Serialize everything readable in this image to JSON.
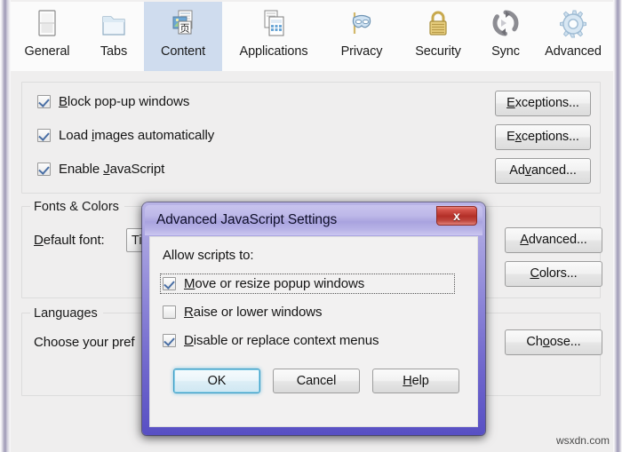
{
  "window": {
    "toolbar_tabs": [
      {
        "label": "General",
        "icon": "document-page-icon",
        "selected": false
      },
      {
        "label": "Tabs",
        "icon": "folder-tab-icon",
        "selected": false
      },
      {
        "label": "Content",
        "icon": "content-pages-icon",
        "selected": true
      },
      {
        "label": "Applications",
        "icon": "applications-icon",
        "selected": false
      },
      {
        "label": "Privacy",
        "icon": "mask-icon",
        "selected": false
      },
      {
        "label": "Security",
        "icon": "padlock-icon",
        "selected": false
      },
      {
        "label": "Sync",
        "icon": "sync-arrows-icon",
        "selected": false
      },
      {
        "label": "Advanced",
        "icon": "gear-icon",
        "selected": false
      }
    ]
  },
  "content_panel": {
    "checkboxes": [
      {
        "label_pre": "",
        "mnemonic": "B",
        "label_post": "lock pop-up windows",
        "checked": true
      },
      {
        "label_pre": "Load ",
        "mnemonic": "i",
        "label_post": "mages automatically",
        "checked": true
      },
      {
        "label_pre": "Enable ",
        "mnemonic": "J",
        "label_post": "avaScript",
        "checked": true
      }
    ],
    "side_buttons": [
      {
        "label_pre": "",
        "mnemonic": "E",
        "label_post": "xceptions..."
      },
      {
        "label_pre": "E",
        "mnemonic": "x",
        "label_post": "ceptions..."
      },
      {
        "label_pre": "Ad",
        "mnemonic": "v",
        "label_post": "anced..."
      }
    ],
    "fonts_group": {
      "legend": "Fonts & Colors",
      "default_font_label_pre": "",
      "default_font_mnemonic": "D",
      "default_font_label_post": "efault font:",
      "default_font_value": "Ti",
      "advanced_button": {
        "label_pre": "",
        "mnemonic": "A",
        "label_post": "dvanced..."
      },
      "colors_button": {
        "label_pre": "",
        "mnemonic": "C",
        "label_post": "olors..."
      }
    },
    "languages_group": {
      "legend": "Languages",
      "description": "Choose your pref",
      "choose_button": {
        "label_pre": "Ch",
        "mnemonic": "o",
        "label_post": "ose..."
      }
    }
  },
  "dialog": {
    "title": "Advanced JavaScript Settings",
    "close_label": "x",
    "heading": "Allow scripts to:",
    "checkboxes": [
      {
        "label_pre": "",
        "mnemonic": "M",
        "label_post": "ove or resize popup windows",
        "checked": true,
        "focused": true
      },
      {
        "label_pre": "",
        "mnemonic": "R",
        "label_post": "aise or lower windows",
        "checked": false,
        "focused": false
      },
      {
        "label_pre": "",
        "mnemonic": "D",
        "label_post": "isable or replace context menus",
        "checked": true,
        "focused": false
      }
    ],
    "buttons": [
      {
        "label_pre": "OK",
        "mnemonic": "",
        "label_post": "",
        "default": true
      },
      {
        "label_pre": "Cancel",
        "mnemonic": "",
        "label_post": "",
        "default": false
      },
      {
        "label_pre": "",
        "mnemonic": "H",
        "label_post": "elp",
        "default": false
      }
    ]
  },
  "watermark": "wsxdn.com"
}
